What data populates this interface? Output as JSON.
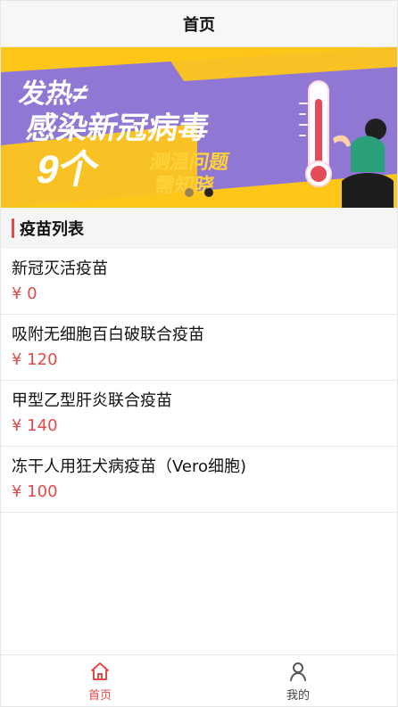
{
  "header": {
    "title": "首页"
  },
  "banner": {
    "text_line1": "发热≠",
    "text_line2": "感染新冠病毒",
    "text_line3_count": "9个",
    "text_line3_a": "测温问题",
    "text_line3_b": "需知晓",
    "active_dot_index": 1,
    "dots_count": 2
  },
  "section": {
    "title": "疫苗列表"
  },
  "vaccines": [
    {
      "name": "新冠灭活疫苗",
      "price": "¥ 0"
    },
    {
      "name": "吸附无细胞百白破联合疫苗",
      "price": "¥ 120"
    },
    {
      "name": "甲型乙型肝炎联合疫苗",
      "price": "¥ 140"
    },
    {
      "name": "冻干人用狂犬病疫苗（Vero细胞)",
      "price": "¥ 100"
    }
  ],
  "tabbar": {
    "items": [
      {
        "label": "首页",
        "icon": "home-icon",
        "active": true
      },
      {
        "label": "我的",
        "icon": "user-icon",
        "active": false
      }
    ]
  },
  "colors": {
    "accent": "#e24b4b",
    "banner_yellow": "#ffc61a",
    "banner_purple": "#8f77d3"
  }
}
